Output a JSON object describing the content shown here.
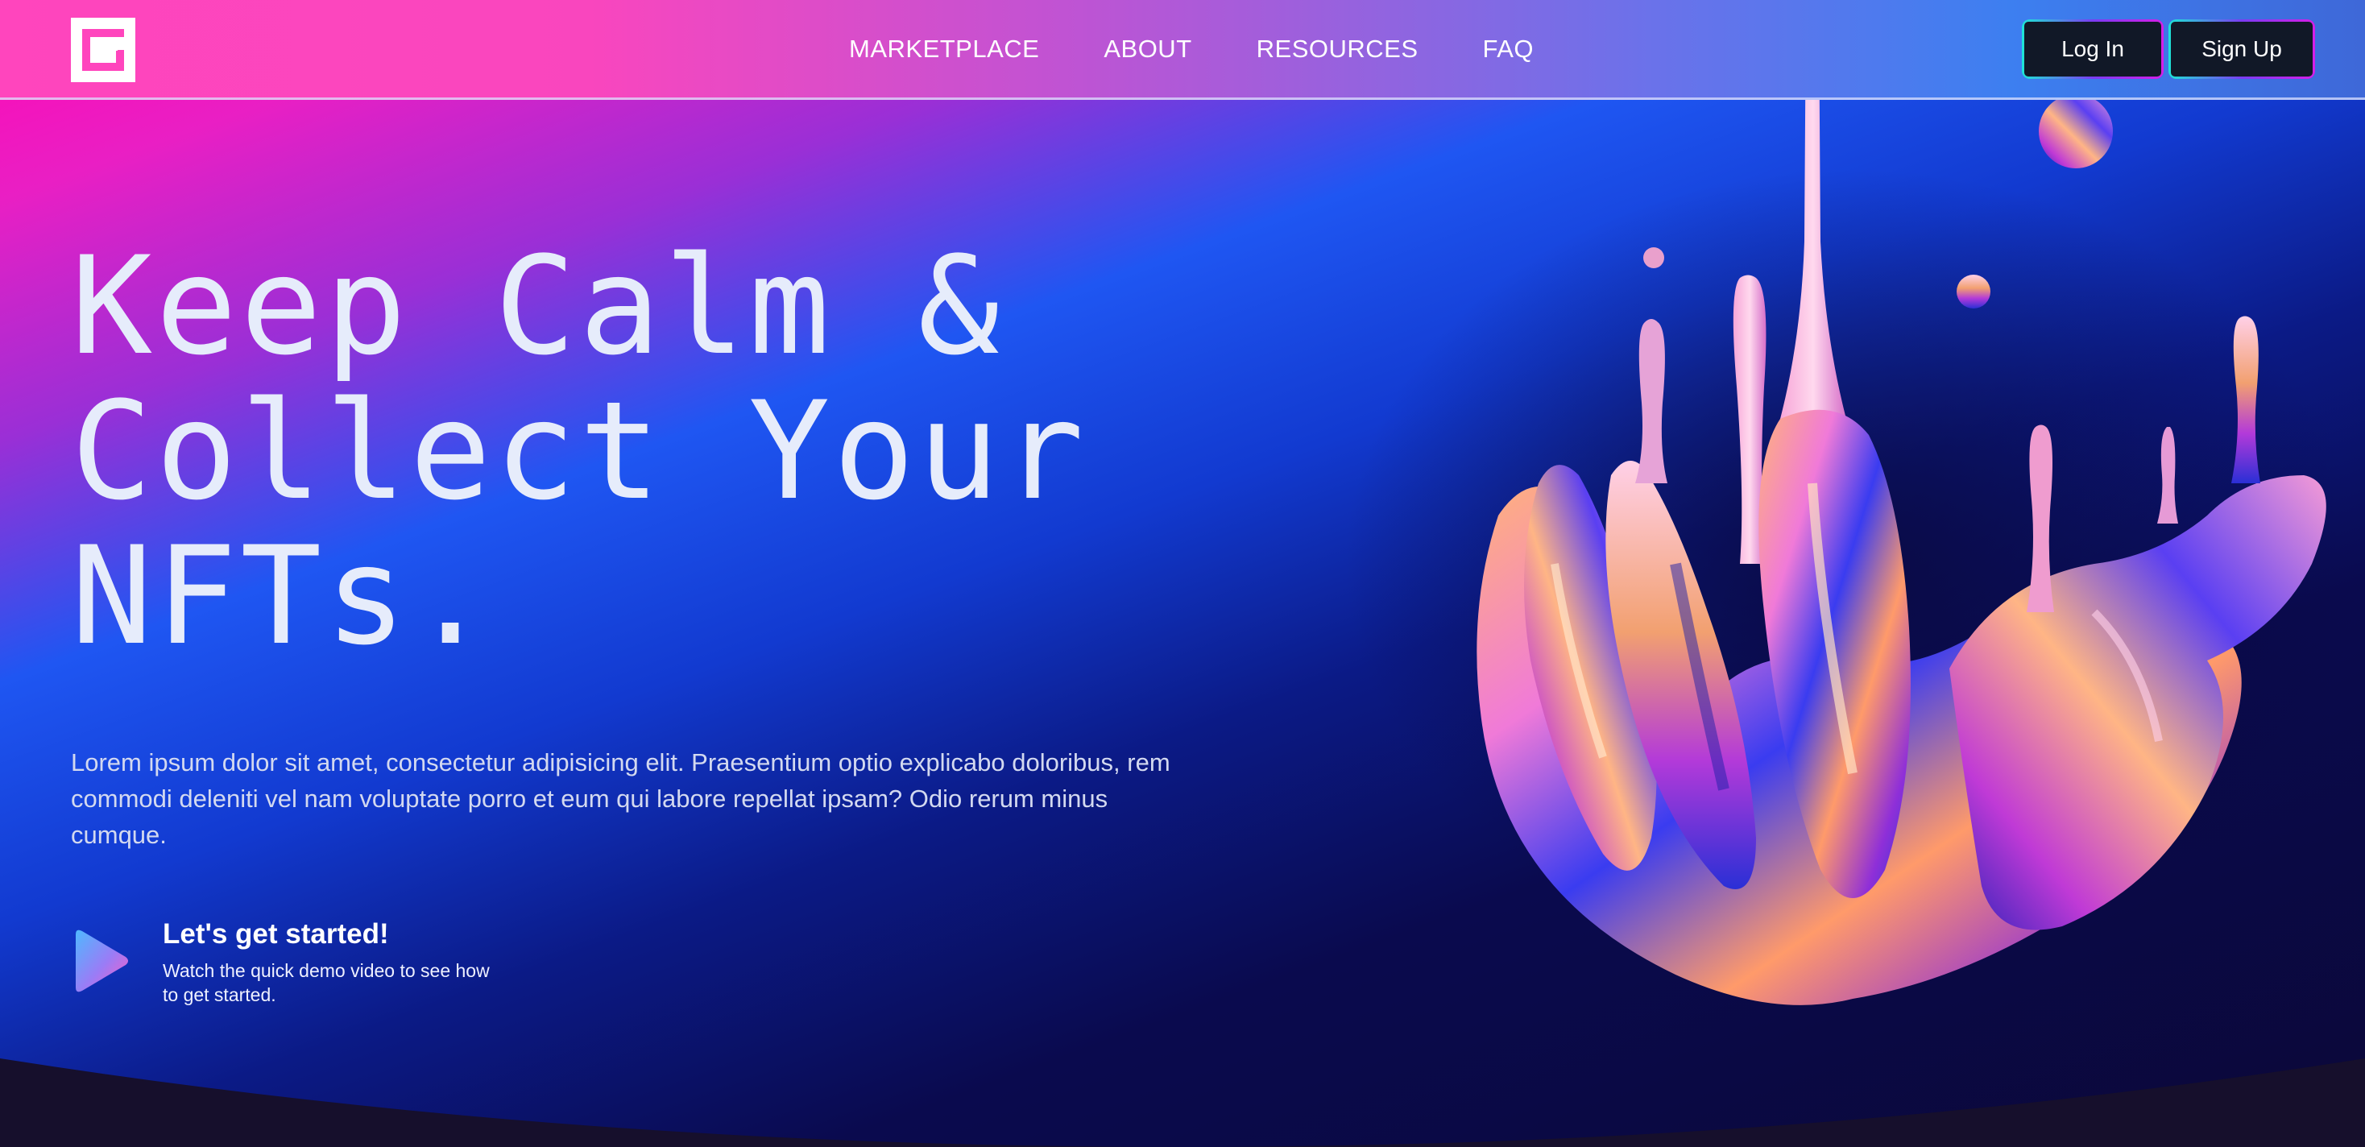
{
  "header": {
    "nav": [
      "MARKETPLACE",
      "ABOUT",
      "RESOURCES",
      "FAQ"
    ],
    "login_label": "Log In",
    "signup_label": "Sign Up"
  },
  "hero": {
    "title_lines": [
      "Keep Calm &",
      "Collect Your",
      "NFTs."
    ],
    "description": "Lorem ipsum dolor sit amet, consectetur adipisicing elit. Praesentium optio explicabo doloribus, rem commodi deleniti vel nam voluptate porro et eum qui labore repellat ipsam? Odio rerum minus cumque.",
    "cta_title": "Let's get started!",
    "cta_subtitle": "Watch the quick demo video to see how to get started."
  },
  "icons": {
    "logo": "logo-icon",
    "play": "play-icon"
  },
  "colors": {
    "header_start": "#ff45bd",
    "header_end": "#3e68d8",
    "button_bg": "#111827",
    "button_border_start": "#1de5d6",
    "button_border_end": "#d61ee8",
    "title_text": "#e6ecfb",
    "page_bottom": "#160f2c"
  }
}
